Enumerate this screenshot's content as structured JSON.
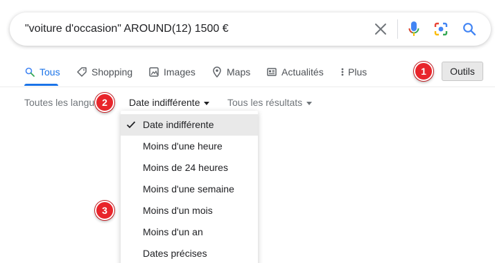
{
  "search": {
    "query": "\"voiture d'occasion\" AROUND(12) 1500 €"
  },
  "icons": {
    "clear": "close-icon",
    "mic": "microphone-icon",
    "lens": "camera-lens-icon",
    "search": "search-icon"
  },
  "colors": {
    "accent": "#1a73e8",
    "marker": "#e8252b"
  },
  "tabs": [
    {
      "label": "Tous",
      "icon": "search-icon",
      "active": true
    },
    {
      "label": "Shopping",
      "icon": "tag-icon"
    },
    {
      "label": "Images",
      "icon": "image-icon"
    },
    {
      "label": "Maps",
      "icon": "map-pin-icon"
    },
    {
      "label": "Actualités",
      "icon": "news-icon"
    },
    {
      "label": "Plus",
      "icon": "more-vert-icon"
    }
  ],
  "tools": {
    "label": "Outils"
  },
  "filters": {
    "language": "Toutes les langues",
    "date": "Date indifférente",
    "results": "Tous les résultats"
  },
  "date_menu": {
    "items": [
      {
        "label": "Date indifférente",
        "selected": true
      },
      {
        "label": "Moins d'une heure"
      },
      {
        "label": "Moins de 24 heures"
      },
      {
        "label": "Moins d'une semaine"
      },
      {
        "label": "Moins d'un mois"
      },
      {
        "label": "Moins d'un an"
      },
      {
        "label": "Dates précises"
      }
    ]
  },
  "markers": [
    "1",
    "2",
    "3"
  ]
}
